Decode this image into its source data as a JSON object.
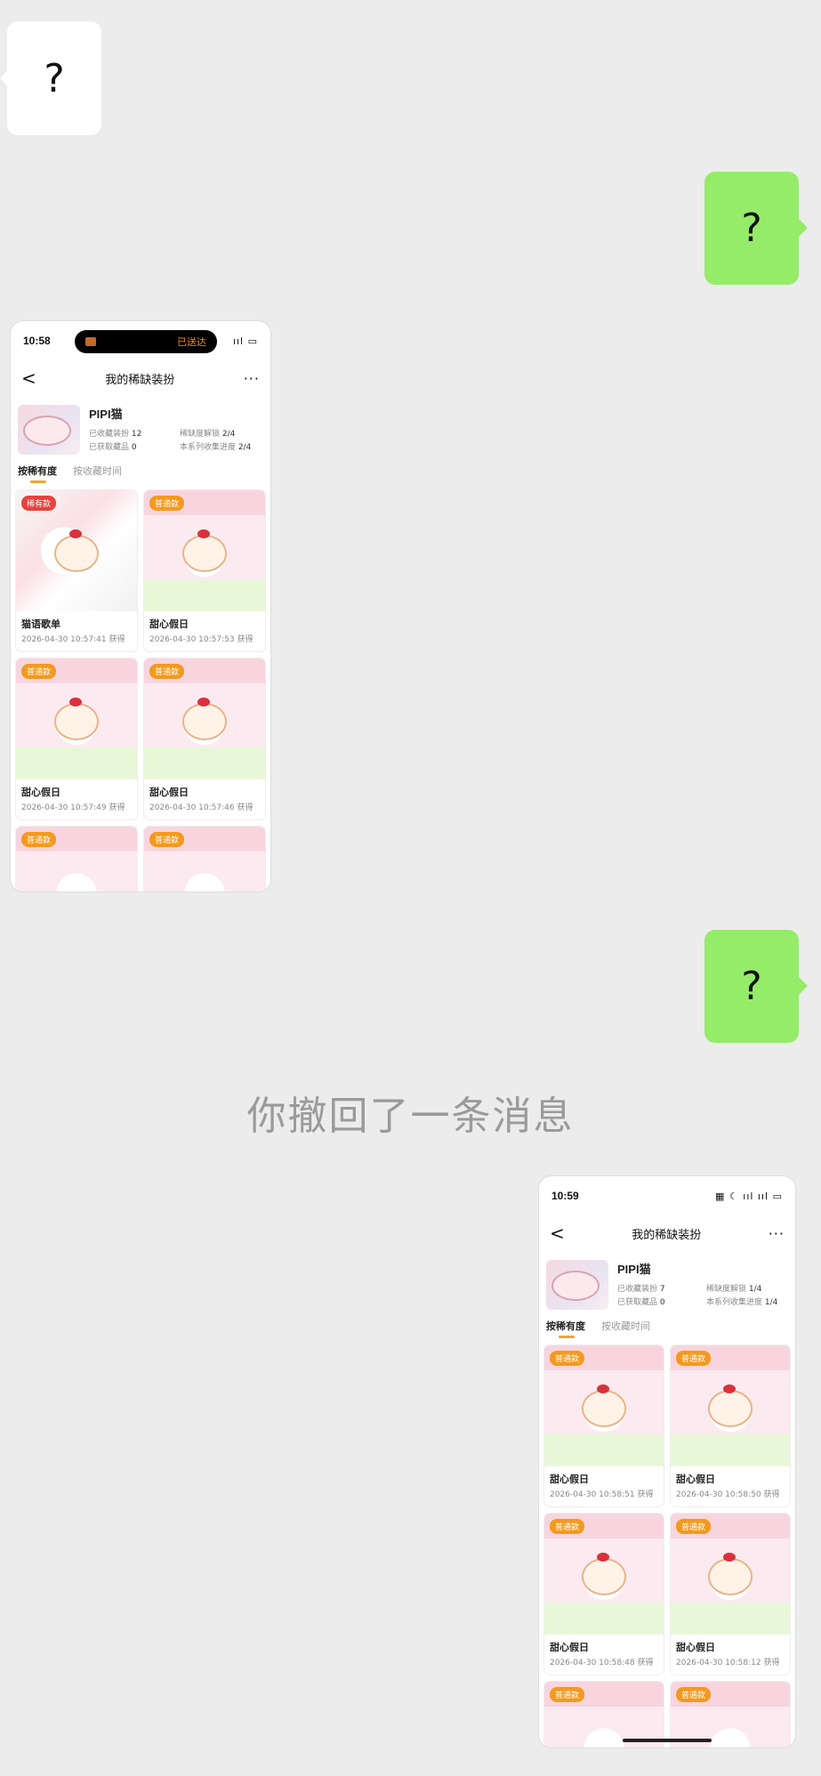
{
  "messages": {
    "m1": "?",
    "m2": "?",
    "m3": "?",
    "recalled": "你撤回了一条消息"
  },
  "screenshot1": {
    "time": "10:58",
    "island_text": "已送达",
    "sys_icons": "ııl ▭",
    "title": "我的稀缺装扮",
    "back": "<",
    "more": "···",
    "profile_name": "PIPI猫",
    "stats": [
      {
        "label": "已收藏装扮",
        "value": "12"
      },
      {
        "label": "稀缺度解锁",
        "value": "2/4"
      },
      {
        "label": "已获取藏品",
        "value": "0"
      },
      {
        "label": "本系列收集进度",
        "value": "2/4"
      }
    ],
    "tabs": [
      "按稀有度",
      "按收藏时间"
    ],
    "cards": [
      {
        "badge": "稀有款",
        "name": "猫语歌单",
        "date": "2026-04-30 10:57:41 获得"
      },
      {
        "badge": "普通款",
        "name": "甜心假日",
        "date": "2026-04-30 10:57:53 获得"
      },
      {
        "badge": "普通款",
        "name": "甜心假日",
        "date": "2026-04-30 10:57:49 获得"
      },
      {
        "badge": "普通款",
        "name": "甜心假日",
        "date": "2026-04-30 10:57:46 获得"
      },
      {
        "badge": "普通款"
      },
      {
        "badge": "普通款"
      }
    ]
  },
  "screenshot2": {
    "time": "10:59",
    "sys_icons": "▦ ☾ ııl ııl ▭",
    "title": "我的稀缺装扮",
    "back": "<",
    "more": "···",
    "profile_name": "PIPI猫",
    "stats": [
      {
        "label": "已收藏装扮",
        "value": "7"
      },
      {
        "label": "稀缺度解锁",
        "value": "1/4"
      },
      {
        "label": "已获取藏品",
        "value": "0"
      },
      {
        "label": "本系列收集进度",
        "value": "1/4"
      }
    ],
    "tabs": [
      "按稀有度",
      "按收藏时间"
    ],
    "cards": [
      {
        "badge": "普通款",
        "name": "甜心假日",
        "date": "2026-04-30 10:58:51 获得"
      },
      {
        "badge": "普通款",
        "name": "甜心假日",
        "date": "2026-04-30 10:58:50 获得"
      },
      {
        "badge": "普通款",
        "name": "甜心假日",
        "date": "2026-04-30 10:58:48 获得"
      },
      {
        "badge": "普通款",
        "name": "甜心假日",
        "date": "2026-04-30 10:58:12 获得"
      },
      {
        "badge": "普通款"
      },
      {
        "badge": "普通款"
      }
    ]
  }
}
